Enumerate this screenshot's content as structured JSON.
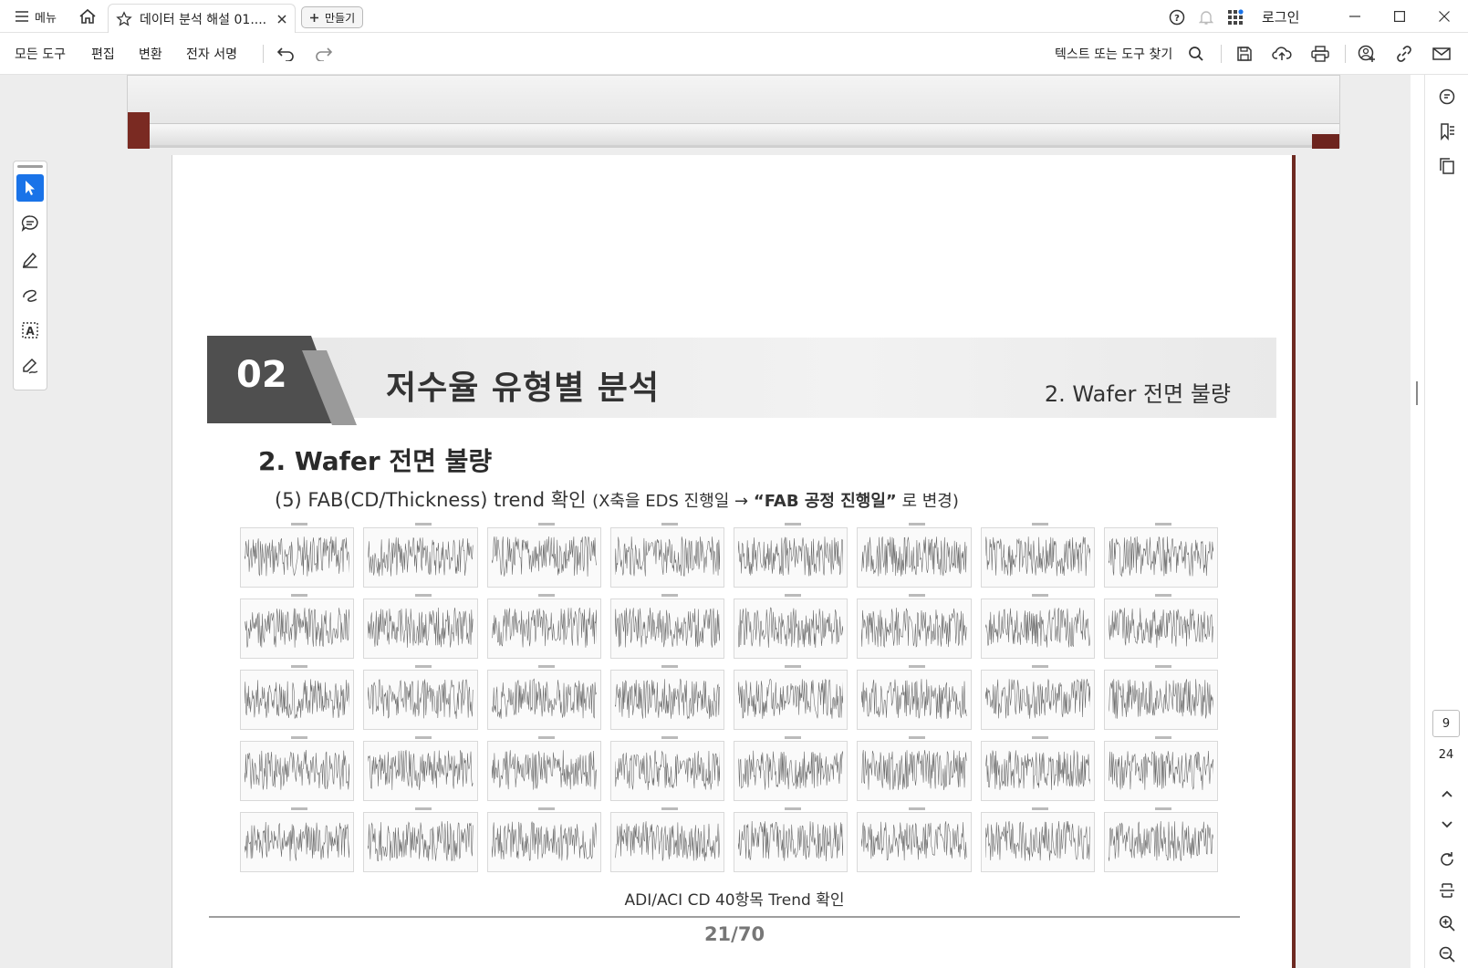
{
  "titlebar": {
    "menu_label": "메뉴",
    "tab_title": "데이터 분석 해설 01....",
    "create_label": "만들기",
    "login_label": "로그인"
  },
  "toolbar": {
    "items": [
      "모든 도구",
      "편집",
      "변환",
      "전자 서명"
    ],
    "search_label": "텍스트 또는 도구 찾기"
  },
  "document": {
    "section_number": "02",
    "section_title": "저수율 유형별 분석",
    "section_subtitle": "2. Wafer 전면 불량",
    "heading": "2. Wafer 전면 불량",
    "subheading_main": "(5) FAB(CD/Thickness) trend 확인",
    "subheading_note_pre": "(X축을 EDS 진행일 → ",
    "subheading_note_bold": "“FAB 공정 진행일”",
    "subheading_note_post": " 로 변경)",
    "chart_count": 40,
    "caption": "ADI/ACI CD 40항목 Trend 확인",
    "page_number": "21/70"
  },
  "navigation": {
    "current_page": "9",
    "total_pages": "24"
  },
  "icons": {
    "titlebar": [
      "menu-icon",
      "home-icon",
      "star-icon",
      "close-tab-icon",
      "plus-icon",
      "help-icon",
      "bell-icon",
      "apps-icon",
      "minimize-icon",
      "maximize-icon",
      "close-window-icon"
    ],
    "toolbar": [
      "undo-icon",
      "redo-icon",
      "search-icon",
      "save-icon",
      "upload-icon",
      "print-icon",
      "share-user-icon",
      "link-icon",
      "mail-icon"
    ],
    "tools": [
      "select-arrow-icon",
      "comment-icon",
      "highlight-pen-icon",
      "freehand-draw-icon",
      "text-select-icon",
      "signature-icon"
    ],
    "rightrail": [
      "comments-panel-icon",
      "bookmarks-icon",
      "pages-icon",
      "chevron-up-icon",
      "chevron-down-icon",
      "rotate-icon",
      "fit-page-icon",
      "zoom-in-icon",
      "zoom-out-icon"
    ]
  },
  "colors": {
    "accent": "#1a73e8",
    "banner_dark": "#4f4f4f",
    "workspace_bg": "#ededed"
  }
}
